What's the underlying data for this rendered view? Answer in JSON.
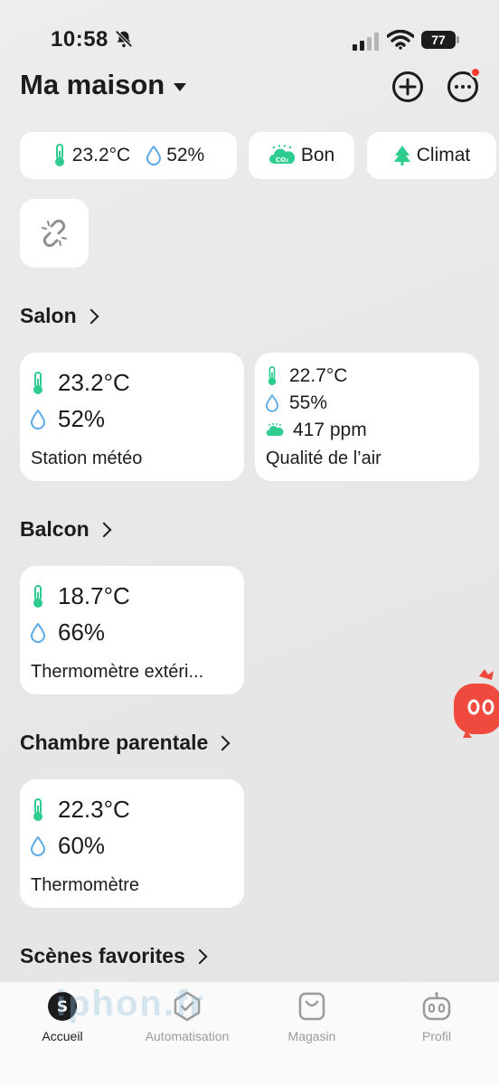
{
  "status_bar": {
    "time": "10:58",
    "battery": "77"
  },
  "header": {
    "title": "Ma maison"
  },
  "summary_chips": {
    "temperature": "23.2°C",
    "humidity": "52%",
    "air_quality": "Bon",
    "climate": "Climat"
  },
  "rooms": [
    {
      "name": "Salon",
      "devices": [
        {
          "temperature": "23.2°C",
          "humidity": "52%",
          "name": "Station météo"
        },
        {
          "temperature": "22.7°C",
          "humidity": "55%",
          "co2": "417 ppm",
          "name": "Qualité de l’air"
        }
      ]
    },
    {
      "name": "Balcon",
      "devices": [
        {
          "temperature": "18.7°C",
          "humidity": "66%",
          "name": "Thermomètre extéri..."
        }
      ]
    },
    {
      "name": "Chambre parentale",
      "devices": [
        {
          "temperature": "22.3°C",
          "humidity": "60%",
          "name": "Thermomètre"
        }
      ]
    }
  ],
  "favorites_title": "Scènes favorites",
  "tabs": [
    {
      "label": "Accueil",
      "icon": "home-icon",
      "active": true
    },
    {
      "label": "Automatisation",
      "icon": "automation-icon",
      "active": false
    },
    {
      "label": "Magasin",
      "icon": "shopping-bag-icon",
      "active": false
    },
    {
      "label": "Profil",
      "icon": "profile-robot-icon",
      "active": false
    }
  ],
  "watermark": "iphon.fr",
  "colors": {
    "accent_green": "#2ecc8f",
    "humidity_blue": "#5aa9e6",
    "notification_red": "#ff3b30",
    "robot_red": "#f04a3f"
  }
}
